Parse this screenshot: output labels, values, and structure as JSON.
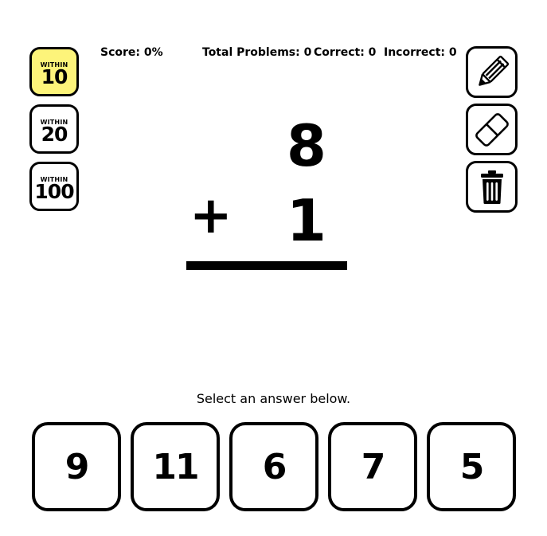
{
  "ranges": [
    {
      "within": "WITHIN",
      "value": "10",
      "active": true
    },
    {
      "within": "WITHIN",
      "value": "20",
      "active": false
    },
    {
      "within": "WITHIN",
      "value": "100",
      "active": false
    }
  ],
  "stats": {
    "score": "Score: 0%",
    "total": "Total Problems: 0",
    "correct": "Correct: 0",
    "incorrect": "Incorrect: 0"
  },
  "tools": [
    {
      "icon": "pencil-icon"
    },
    {
      "icon": "eraser-icon"
    },
    {
      "icon": "trash-icon"
    }
  ],
  "problem": {
    "top": "8",
    "operator": "+",
    "bottom": "1"
  },
  "instruction": "Select an answer below.",
  "answers": [
    "9",
    "11",
    "6",
    "7",
    "5"
  ],
  "colors": {
    "active_range": "#fdf47a",
    "border": "#000000",
    "background": "#ffffff"
  }
}
